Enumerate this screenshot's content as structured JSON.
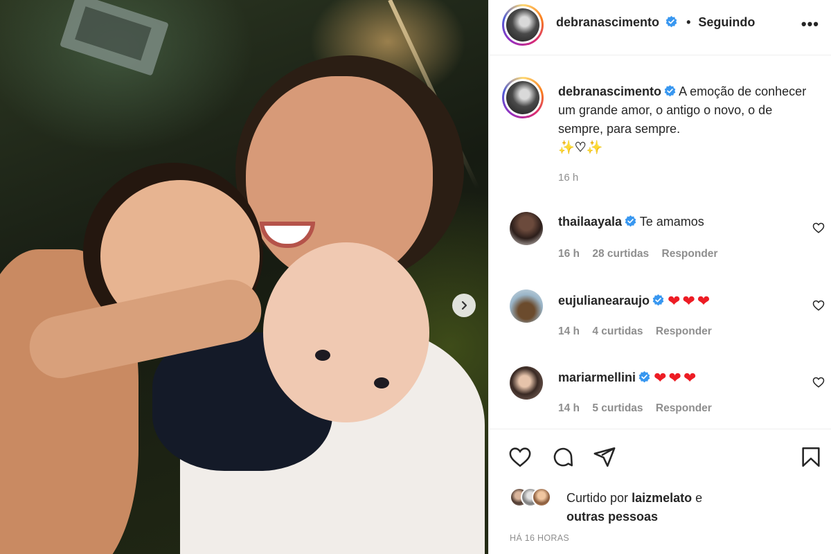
{
  "header": {
    "username": "debranascimento",
    "separator": "•",
    "follow_status": "Seguindo",
    "more_label": "•••"
  },
  "caption": {
    "username": "debranascimento",
    "text": "A emoção de conhecer um grande amor, o antigo o novo, o de sempre, para sempre.",
    "emoji": "✨♡✨",
    "time": "16 h"
  },
  "comments": [
    {
      "username": "thailaayala",
      "text": "Te amamos",
      "time": "16 h",
      "likes": "28 curtidas",
      "reply": "Responder"
    },
    {
      "username": "eujulianearaujo",
      "text": "❤❤❤",
      "time": "14 h",
      "likes": "4 curtidas",
      "reply": "Responder"
    },
    {
      "username": "mariarmellini",
      "text": "❤❤❤",
      "time": "14 h",
      "likes": "5 curtidas",
      "reply": "Responder"
    }
  ],
  "likes": {
    "prefix": "Curtido por",
    "liker": "laizmelato",
    "conjunction": "e",
    "others": "outras pessoas"
  },
  "post_timestamp": "HÁ 16 HORAS",
  "icons": {
    "like": "heart-outline-icon",
    "comment": "speech-bubble-icon",
    "share": "paper-plane-icon",
    "save": "bookmark-icon",
    "next": "chevron-right-icon",
    "verified": "verified-badge-icon"
  },
  "colors": {
    "accent_verified": "#3897f0",
    "text_secondary": "#8e8e8e",
    "heart_emoji": "#ed1c24"
  }
}
